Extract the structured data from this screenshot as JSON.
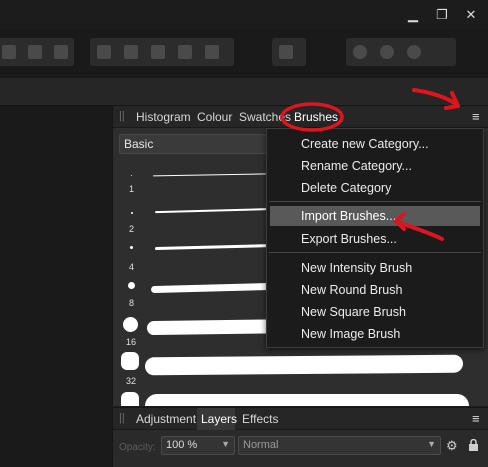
{
  "window": {
    "minimize_glyph": "▁",
    "restore_glyph": "❐",
    "close_glyph": "✕"
  },
  "brushes_panel": {
    "tabs": [
      {
        "label": "Histogram"
      },
      {
        "label": "Colour"
      },
      {
        "label": "Swatches"
      },
      {
        "label": "Brushes",
        "active": true
      }
    ],
    "category": "Basic",
    "brush_sizes": [
      "1",
      "2",
      "4",
      "8",
      "16",
      "32"
    ]
  },
  "menu": {
    "items": [
      {
        "label": "Create new Category..."
      },
      {
        "label": "Rename Category..."
      },
      {
        "label": "Delete Category"
      },
      {
        "label": "Import Brushes...",
        "highlighted": true
      },
      {
        "label": "Export Brushes..."
      },
      {
        "label": "New Intensity Brush"
      },
      {
        "label": "New Round Brush"
      },
      {
        "label": "New Square Brush"
      },
      {
        "label": "New Image Brush"
      }
    ]
  },
  "layers_panel": {
    "tabs": [
      {
        "label": "Adjustment"
      },
      {
        "label": "Layers",
        "active": true
      },
      {
        "label": "Effects"
      }
    ],
    "opacity_label": "Opacity:",
    "opacity_value": "100 %",
    "blend_mode": "Normal"
  },
  "colors": {
    "annotation_red": "#e0141e",
    "menu_highlight": "#595959",
    "panel_bg": "#2e2e2e"
  }
}
